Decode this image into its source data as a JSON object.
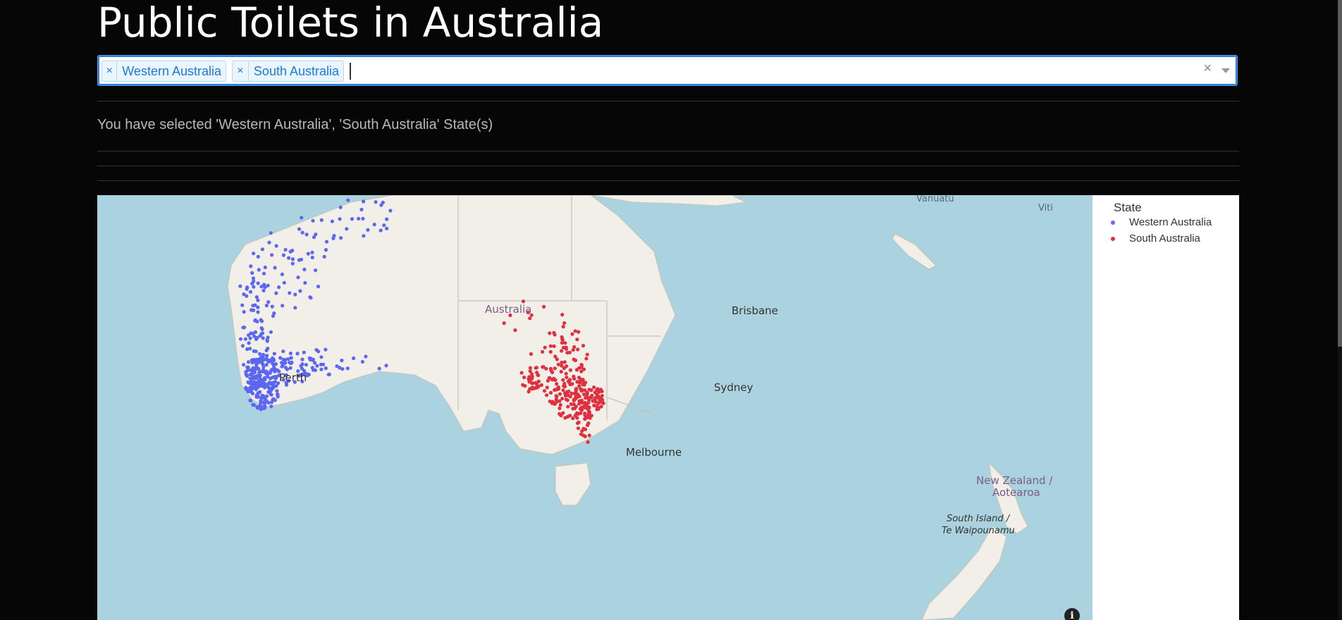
{
  "page": {
    "title": "Public Toilets in Australia"
  },
  "state_select": {
    "chips": [
      {
        "remove_icon": "×",
        "label": "Western Australia"
      },
      {
        "remove_icon": "×",
        "label": "South Australia"
      }
    ],
    "clear_icon": "×"
  },
  "selection_message": "You have selected 'Western Australia', 'South Australia' State(s)",
  "map": {
    "labels": {
      "australia": "Australia",
      "brisbane": "Brisbane",
      "sydney": "Sydney",
      "melbourne": "Melbourne",
      "perth": "Perth",
      "vanuatu": "Vanuatu",
      "viti": "Viti",
      "nz1": "New Zealand /",
      "nz2": "Aotearoa",
      "si1": "South Island /",
      "si2": "Te Waipounamu"
    },
    "info_icon": "i"
  },
  "legend": {
    "title": "State",
    "items": [
      {
        "label": "Western Australia",
        "color": "#636efa"
      },
      {
        "label": "South Australia",
        "color": "#e0303f"
      }
    ]
  }
}
